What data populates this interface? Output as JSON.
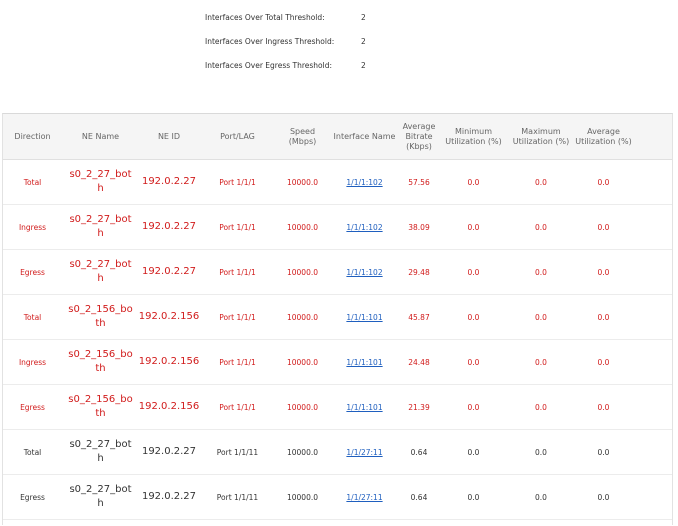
{
  "summary": {
    "total": {
      "label": "Interfaces Over Total Threshold:",
      "value": "2"
    },
    "ingress": {
      "label": "Interfaces Over Ingress Threshold:",
      "value": "2"
    },
    "egress": {
      "label": "Interfaces Over Egress Threshold:",
      "value": "2"
    }
  },
  "table": {
    "headers": {
      "direction": "Direction",
      "ne_name": "NE Name",
      "ne_id": "NE ID",
      "port": "Port/LAG",
      "speed": "Speed (Mbps)",
      "interface": "Interface Name",
      "avg_bitrate": "Average Bitrate (Kbps)",
      "min_util": "Minimum Utilization (%)",
      "max_util": "Maximum Utilization (%)",
      "avg_util": "Average Utilization (%)"
    },
    "rows": [
      {
        "direction": "Total",
        "ne_name": "s0_2_27_both",
        "ne_id": "192.0.2.27",
        "port": "Port 1/1/1",
        "speed": "10000.0",
        "interface": "1/1/1:102",
        "avg_bitrate": "57.56",
        "min": "0.0",
        "max": "0.0",
        "avg": "0.0",
        "status": "red"
      },
      {
        "direction": "Ingress",
        "ne_name": "s0_2_27_both",
        "ne_id": "192.0.2.27",
        "port": "Port 1/1/1",
        "speed": "10000.0",
        "interface": "1/1/1:102",
        "avg_bitrate": "38.09",
        "min": "0.0",
        "max": "0.0",
        "avg": "0.0",
        "status": "red"
      },
      {
        "direction": "Egress",
        "ne_name": "s0_2_27_both",
        "ne_id": "192.0.2.27",
        "port": "Port 1/1/1",
        "speed": "10000.0",
        "interface": "1/1/1:102",
        "avg_bitrate": "29.48",
        "min": "0.0",
        "max": "0.0",
        "avg": "0.0",
        "status": "red"
      },
      {
        "direction": "Total",
        "ne_name": "s0_2_156_both",
        "ne_id": "192.0.2.156",
        "port": "Port 1/1/1",
        "speed": "10000.0",
        "interface": "1/1/1:101",
        "avg_bitrate": "45.87",
        "min": "0.0",
        "max": "0.0",
        "avg": "0.0",
        "status": "red"
      },
      {
        "direction": "Ingress",
        "ne_name": "s0_2_156_both",
        "ne_id": "192.0.2.156",
        "port": "Port 1/1/1",
        "speed": "10000.0",
        "interface": "1/1/1:101",
        "avg_bitrate": "24.48",
        "min": "0.0",
        "max": "0.0",
        "avg": "0.0",
        "status": "red"
      },
      {
        "direction": "Egress",
        "ne_name": "s0_2_156_both",
        "ne_id": "192.0.2.156",
        "port": "Port 1/1/1",
        "speed": "10000.0",
        "interface": "1/1/1:101",
        "avg_bitrate": "21.39",
        "min": "0.0",
        "max": "0.0",
        "avg": "0.0",
        "status": "red"
      },
      {
        "direction": "Total",
        "ne_name": "s0_2_27_both",
        "ne_id": "192.0.2.27",
        "port": "Port 1/1/11",
        "speed": "10000.0",
        "interface": "1/1/27:11",
        "avg_bitrate": "0.64",
        "min": "0.0",
        "max": "0.0",
        "avg": "0.0",
        "status": "black"
      },
      {
        "direction": "Egress",
        "ne_name": "s0_2_27_both",
        "ne_id": "192.0.2.27",
        "port": "Port 1/1/11",
        "speed": "10000.0",
        "interface": "1/1/27:11",
        "avg_bitrate": "0.64",
        "min": "0.0",
        "max": "0.0",
        "avg": "0.0",
        "status": "black"
      }
    ]
  },
  "colors": {
    "over_threshold": "#d11b1b",
    "normal": "#333333",
    "link": "#1f5fbf"
  }
}
